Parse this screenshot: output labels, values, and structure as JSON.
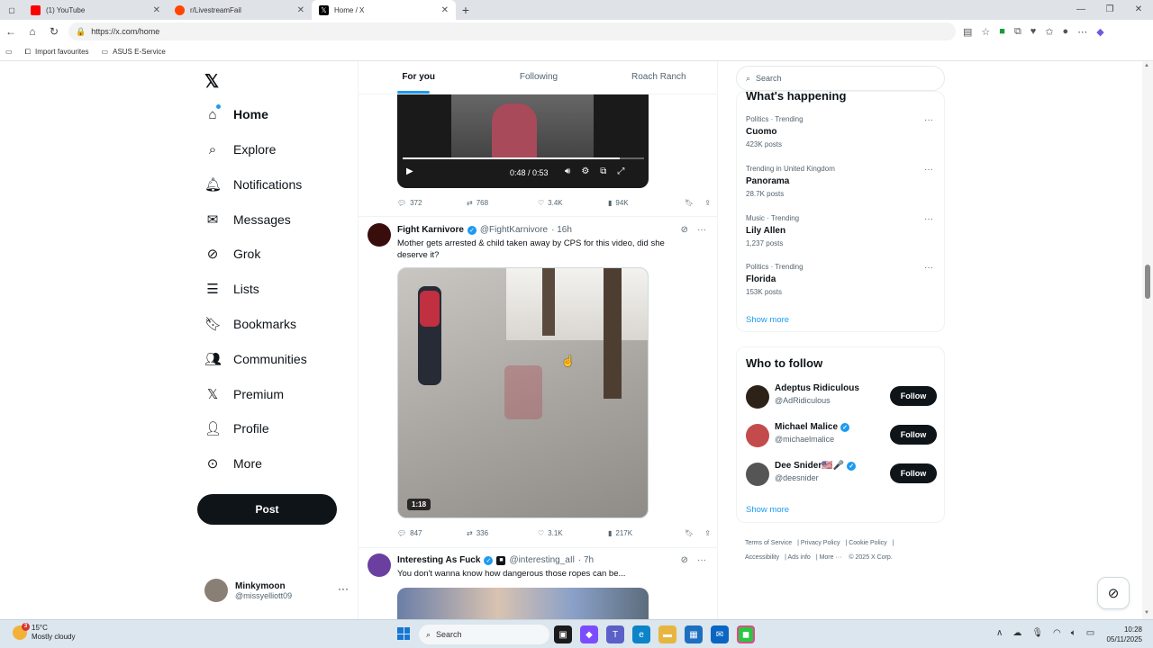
{
  "browser": {
    "tabs": [
      {
        "title": "(1) YouTube",
        "color": "#ff0000"
      },
      {
        "title": "r/LivestreamFail",
        "color": "#ff4500"
      },
      {
        "title": "Home / X",
        "color": "#000000"
      }
    ],
    "url": "https://x.com/home",
    "bookmarks": [
      "Import favourites",
      "ASUS E-Service"
    ]
  },
  "nav": {
    "items": [
      {
        "label": "Home",
        "icon": "home-icon"
      },
      {
        "label": "Explore",
        "icon": "search-icon"
      },
      {
        "label": "Notifications",
        "icon": "bell-icon"
      },
      {
        "label": "Messages",
        "icon": "mail-icon"
      },
      {
        "label": "Grok",
        "icon": "grok-icon"
      },
      {
        "label": "Lists",
        "icon": "list-icon"
      },
      {
        "label": "Bookmarks",
        "icon": "bookmark-icon"
      },
      {
        "label": "Communities",
        "icon": "people-icon"
      },
      {
        "label": "Premium",
        "icon": "x-icon"
      },
      {
        "label": "Profile",
        "icon": "person-icon"
      },
      {
        "label": "More",
        "icon": "more-icon"
      }
    ],
    "post_label": "Post",
    "account": {
      "name": "Minkymoon",
      "handle": "@missyelliott09"
    }
  },
  "feed": {
    "tabs": [
      "For you",
      "Following",
      "Roach Ranch"
    ],
    "tweet1": {
      "video_time": "0:48 / 0:53",
      "video_progress": 0.9,
      "stats": {
        "replies": "372",
        "reposts": "768",
        "likes": "3.4K",
        "views": "94K"
      }
    },
    "tweet2": {
      "name": "Fight Karnivore",
      "handle": "@FightKarnivore",
      "time": "· 16h",
      "text": "Mother gets arrested & child taken away by CPS for this video, did she deserve it?",
      "duration": "1:18",
      "stats": {
        "replies": "847",
        "reposts": "336",
        "likes": "3.1K",
        "views": "217K"
      }
    },
    "tweet3": {
      "name": "Interesting As Fuck",
      "handle": "@interesting_aIl",
      "time": "· 7h",
      "text": "You don't wanna know how dangerous those ropes can be..."
    }
  },
  "sidebar": {
    "search_placeholder": "Search",
    "happening_title": "What's happening",
    "trends": [
      {
        "context": "Politics · Trending",
        "topic": "Cuomo",
        "posts": "423K posts"
      },
      {
        "context": "Trending in United Kingdom",
        "topic": "Panorama",
        "posts": "28.7K posts"
      },
      {
        "context": "Music · Trending",
        "topic": "Lily Allen",
        "posts": "1,237 posts"
      },
      {
        "context": "Politics · Trending",
        "topic": "Florida",
        "posts": "153K posts"
      }
    ],
    "show_more": "Show more",
    "who_to_follow_title": "Who to follow",
    "follow_label": "Follow",
    "who_to_follow": [
      {
        "name": "Adeptus Ridiculous",
        "handle": "@AdRidiculous",
        "verified": false
      },
      {
        "name": "Michael Malice",
        "handle": "@michaelmalice",
        "verified": true
      },
      {
        "name": "Dee Snider🇺🇸🎤",
        "handle": "@deesnider",
        "verified": true
      }
    ],
    "footer": [
      "Terms of Service",
      "Privacy Policy",
      "Cookie Policy",
      "Accessibility",
      "Ads info",
      "More ···",
      "© 2025 X Corp."
    ]
  },
  "taskbar": {
    "weather_temp": "15°C",
    "weather_desc": "Mostly cloudy",
    "search_label": "Search",
    "time": "10:28",
    "date": "05/11/2025"
  }
}
